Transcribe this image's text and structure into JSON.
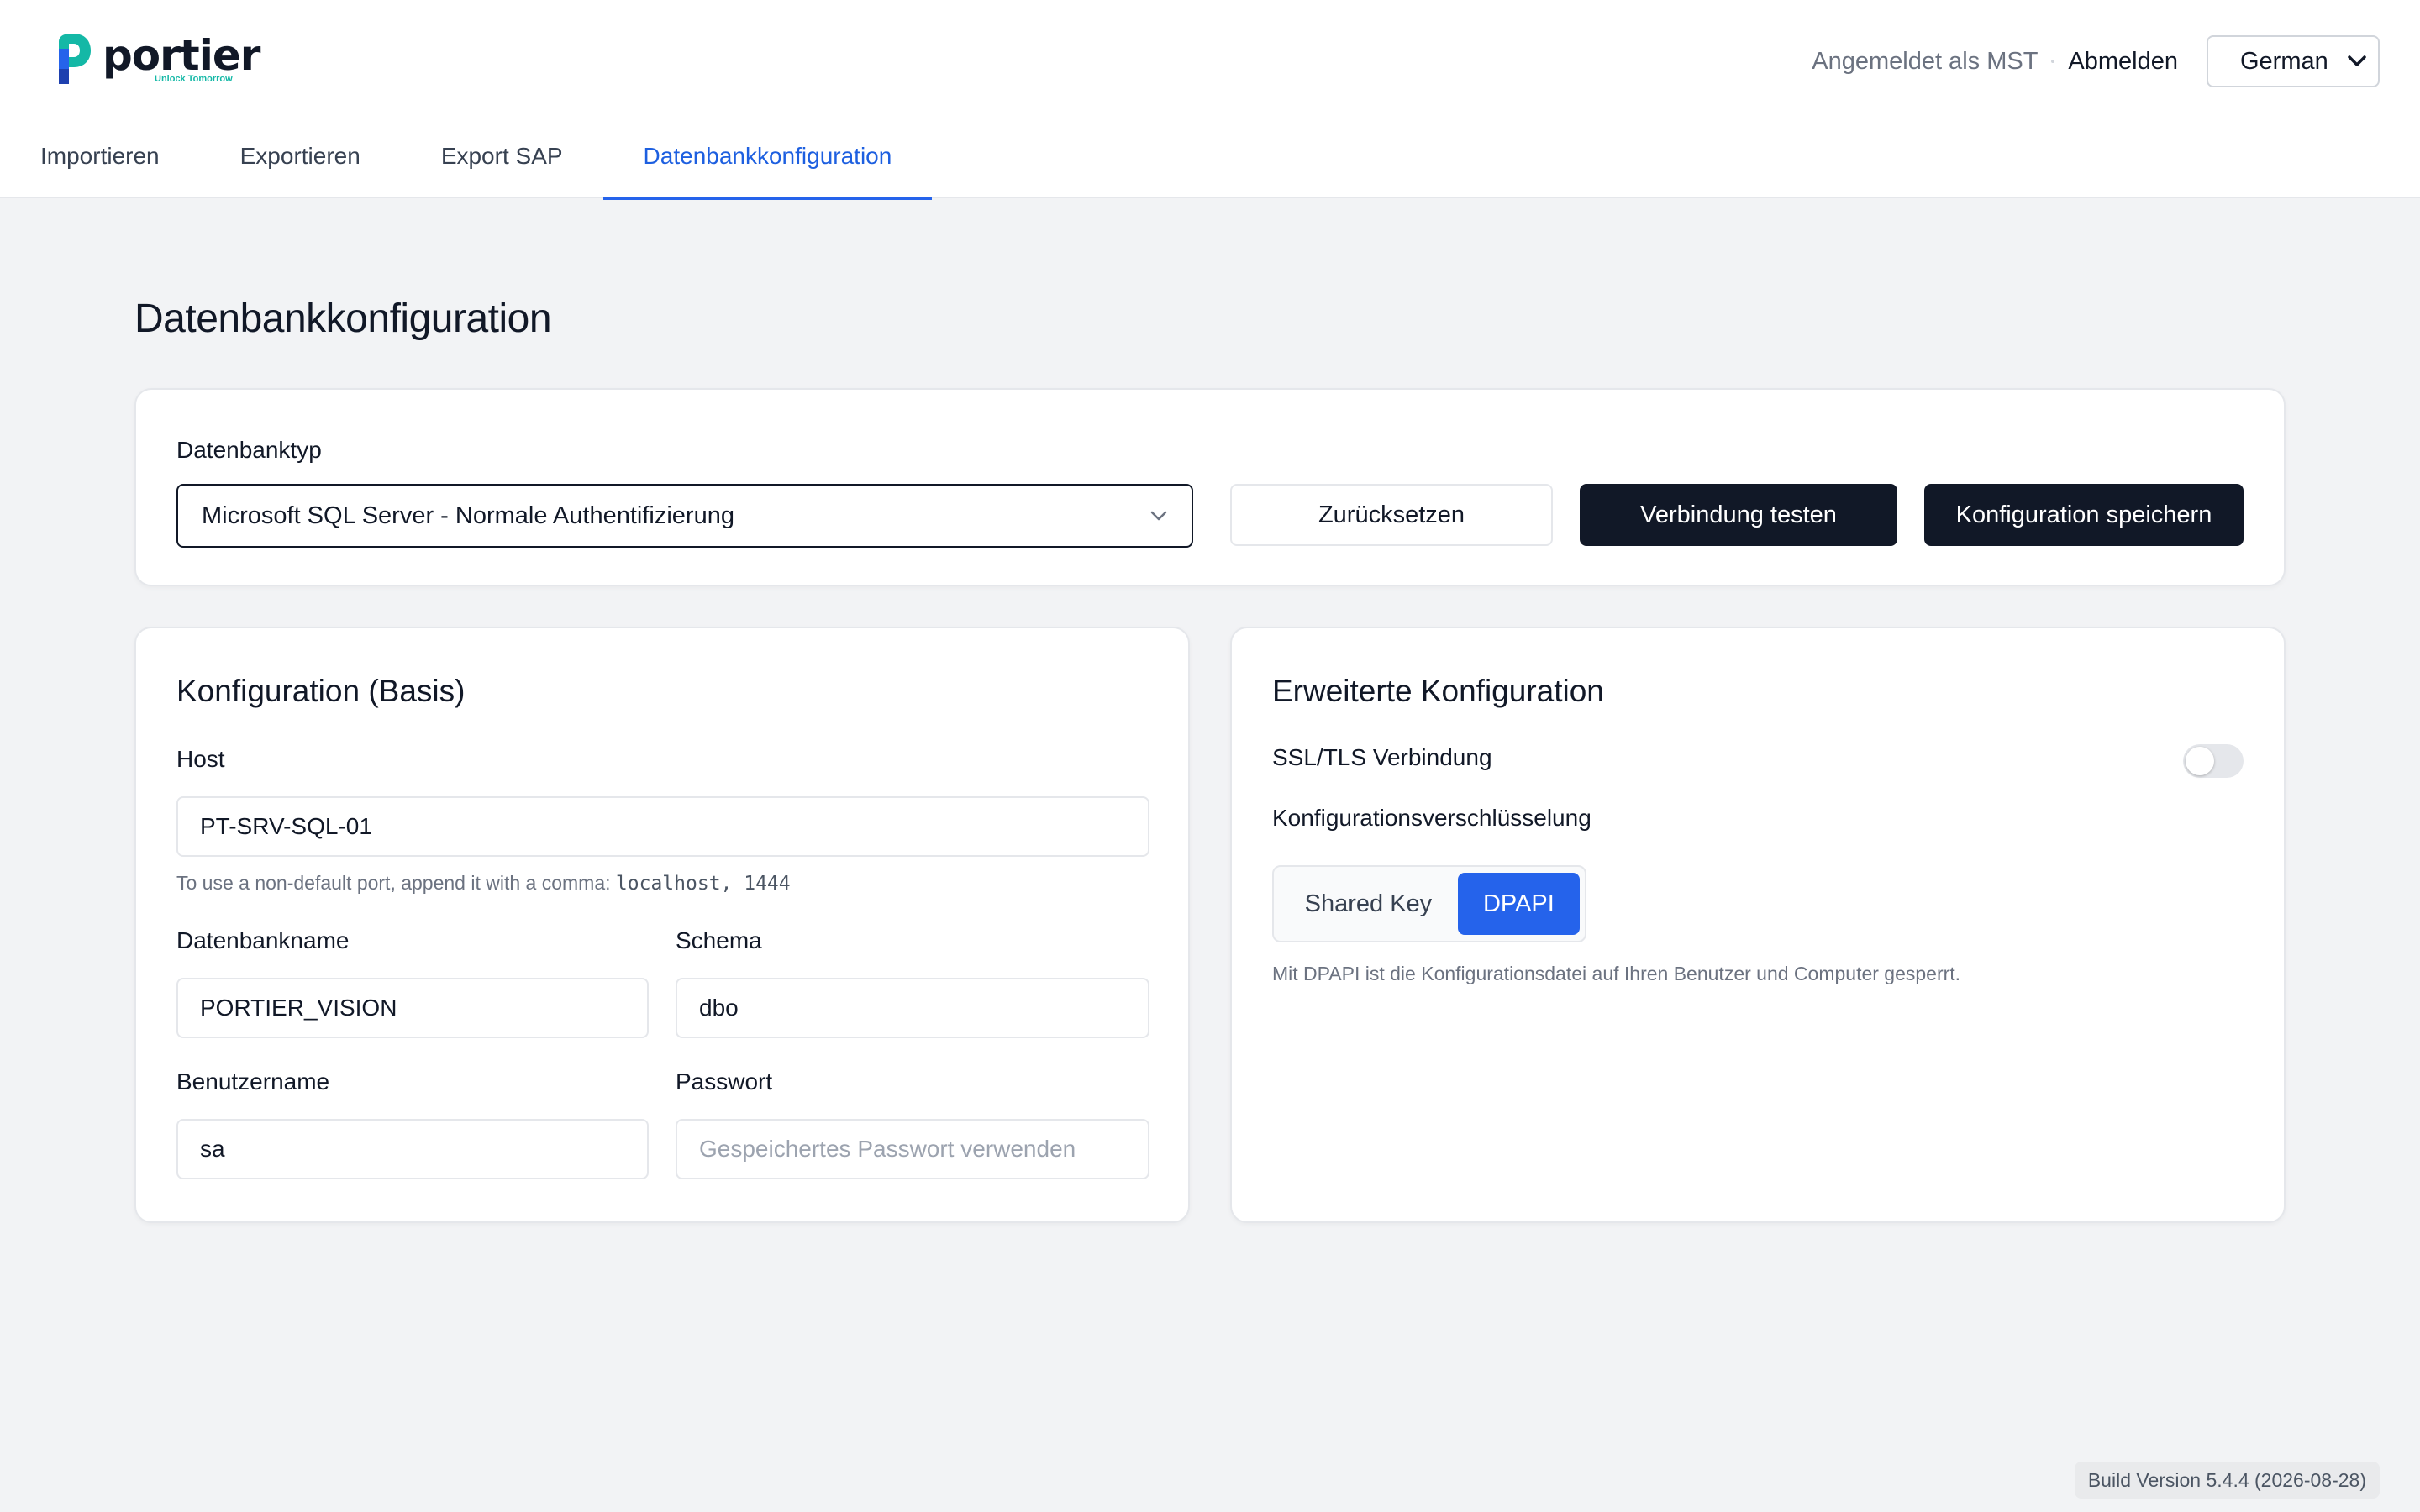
{
  "app": {
    "logo_text": "portier",
    "logo_tagline": "Unlock Tomorrow",
    "brand_colors": {
      "primary_blue": "#2563eb",
      "teal": "#14b8a6",
      "dark": "#111827"
    }
  },
  "header": {
    "logged_in_text": "Angemeldet als MST",
    "logout_label": "Abmelden",
    "language_value": "German"
  },
  "tabs": [
    {
      "label": "Importieren",
      "active": false
    },
    {
      "label": "Exportieren",
      "active": false
    },
    {
      "label": "Export SAP",
      "active": false
    },
    {
      "label": "Datenbankkonfiguration",
      "active": true
    }
  ],
  "page": {
    "title": "Datenbankkonfiguration"
  },
  "db_type": {
    "label": "Datenbanktyp",
    "value": "Microsoft SQL Server - Normale Authentifizierung"
  },
  "actions": {
    "reset_label": "Zurücksetzen",
    "test_label": "Verbindung testen",
    "save_label": "Konfiguration speichern"
  },
  "basic": {
    "heading": "Konfiguration (Basis)",
    "host_label": "Host",
    "host_value": "PT-SRV-SQL-01",
    "host_hint": "To use a non-default port, append it with a comma:",
    "host_hint_code": "localhost, 1444",
    "dbname_label": "Datenbankname",
    "dbname_value": "PORTIER_VISION",
    "schema_label": "Schema",
    "schema_value": "dbo",
    "user_label": "Benutzername",
    "user_value": "sa",
    "password_label": "Passwort",
    "password_placeholder": "Gespeichertes Passwort verwenden"
  },
  "advanced": {
    "heading": "Erweiterte Konfiguration",
    "ssl_label": "SSL/TLS Verbindung",
    "ssl_enabled": false,
    "encryption_label": "Konfigurationsverschlüsselung",
    "encryption_options": [
      "Shared Key",
      "DPAPI"
    ],
    "encryption_selected": "DPAPI",
    "encryption_hint": "Mit DPAPI ist die Konfigurationsdatei auf Ihren Benutzer und Computer gesperrt."
  },
  "footer": {
    "build_version": "Build Version 5.4.4 (2026-08-28)"
  }
}
